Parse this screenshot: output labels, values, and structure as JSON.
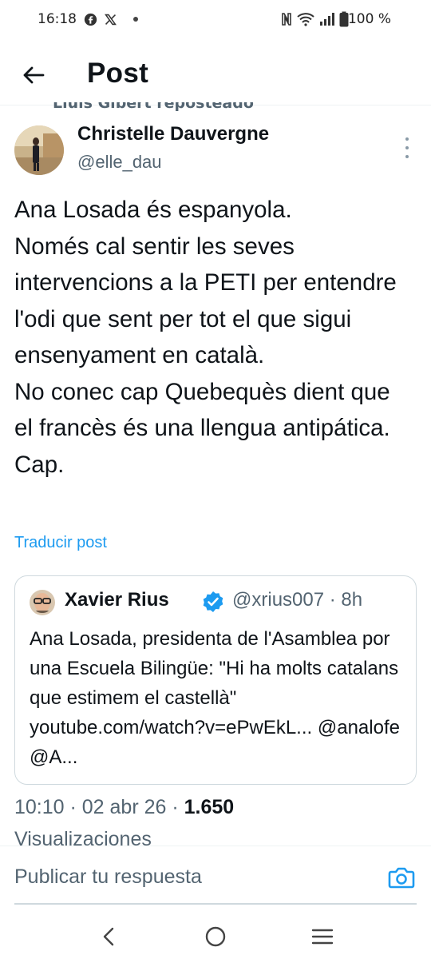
{
  "status_bar": {
    "time": "16:18",
    "battery": "100 %",
    "icons": [
      "facebook-icon",
      "x-icon",
      "dot-icon",
      "nfc-icon",
      "wifi-icon",
      "signal-icon",
      "battery-icon"
    ]
  },
  "header": {
    "title": "Post",
    "back_icon": "arrow-left-icon"
  },
  "repost_label": "Lluis Gibert reposteado",
  "post": {
    "author_name": "Christelle Dauvergne",
    "author_handle": "@elle_dau",
    "text": "Ana Losada és espanyola.\nNomés cal sentir les seves intervencions a la PETI per entendre l'odi que sent per tot el que sigui ensenyament en català.\nNo conec cap Quebequès dient que el francès és una llengua antipática. Cap.",
    "translate_label": "Traducir post"
  },
  "quote": {
    "author_name": "Xavier Rius",
    "author_handle": "@xrius007 · 8h",
    "text": "Ana Losada, presidenta de l'Asamblea por una Escuela Bilingüe: \"Hi ha molts catalans que estimem el castellà\" youtube.com/watch?v=ePwEkL... @analofe @A..."
  },
  "meta": {
    "datetime": "10:10 · 02 abr 26 · ",
    "views_count": "1.650",
    "views_label": "Visualizaciones"
  },
  "reply": {
    "placeholder": "Publicar tu respuesta",
    "camera_icon": "camera-icon"
  },
  "colors": {
    "accent": "#1d9bf0",
    "text_primary": "#0f1419",
    "text_secondary": "#536471",
    "border": "#cfd9de"
  }
}
